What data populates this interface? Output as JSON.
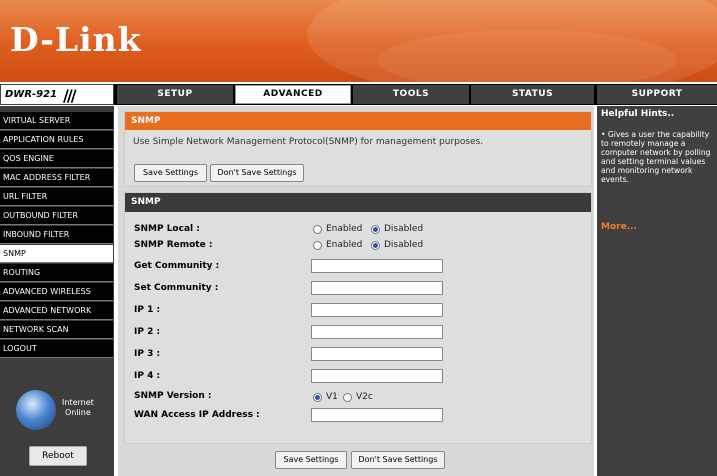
{
  "brand": {
    "logo": "D-Link",
    "model": "DWR-921",
    "slashes": "///"
  },
  "nav": {
    "tabs": [
      "SETUP",
      "ADVANCED",
      "TOOLS",
      "STATUS",
      "SUPPORT"
    ],
    "active": "ADVANCED"
  },
  "sidebar": {
    "items": [
      "VIRTUAL SERVER",
      "APPLICATION RULES",
      "QOS ENGINE",
      "MAC ADDRESS FILTER",
      "URL FILTER",
      "OUTBOUND FILTER",
      "INBOUND FILTER",
      "SNMP",
      "ROUTING",
      "ADVANCED WIRELESS",
      "ADVANCED NETWORK",
      "NETWORK SCAN",
      "LOGOUT"
    ],
    "active": "SNMP",
    "status_line1": "Internet",
    "status_line2": "Online",
    "reboot_label": "Reboot"
  },
  "intro": {
    "title": "SNMP",
    "description": "Use Simple Network Management Protocol(SNMP) for management purposes.",
    "save_label": "Save Settings",
    "dont_save_label": "Don't Save Settings"
  },
  "form": {
    "title": "SNMP",
    "snmp_local": {
      "label": "SNMP Local :",
      "enabled_label": "Enabled",
      "disabled_label": "Disabled",
      "selected": "Disabled"
    },
    "snmp_remote": {
      "label": "SNMP Remote :",
      "enabled_label": "Enabled",
      "disabled_label": "Disabled",
      "selected": "Disabled"
    },
    "get_community": {
      "label": "Get Community :",
      "value": ""
    },
    "set_community": {
      "label": "Set Community :",
      "value": ""
    },
    "ip1": {
      "label": "IP 1 :",
      "value": ""
    },
    "ip2": {
      "label": "IP 2 :",
      "value": ""
    },
    "ip3": {
      "label": "IP 3 :",
      "value": ""
    },
    "ip4": {
      "label": "IP 4 :",
      "value": ""
    },
    "snmp_version": {
      "label": "SNMP Version :",
      "v1_label": "V1",
      "v2c_label": "V2c",
      "selected": "V1"
    },
    "wan_access": {
      "label": "WAN Access IP Address :",
      "value": ""
    },
    "save_label": "Save Settings",
    "dont_save_label": "Don't Save Settings"
  },
  "hints": {
    "title": "Helpful Hints..",
    "body": "• Gives a user the capability to remotely manage a computer network by polling and setting terminal values and monitoring network events.",
    "more": "More..."
  },
  "colors": {
    "accent": "#e96d1e",
    "nav_bg": "#404040",
    "section_head": "#3a3a3a"
  }
}
